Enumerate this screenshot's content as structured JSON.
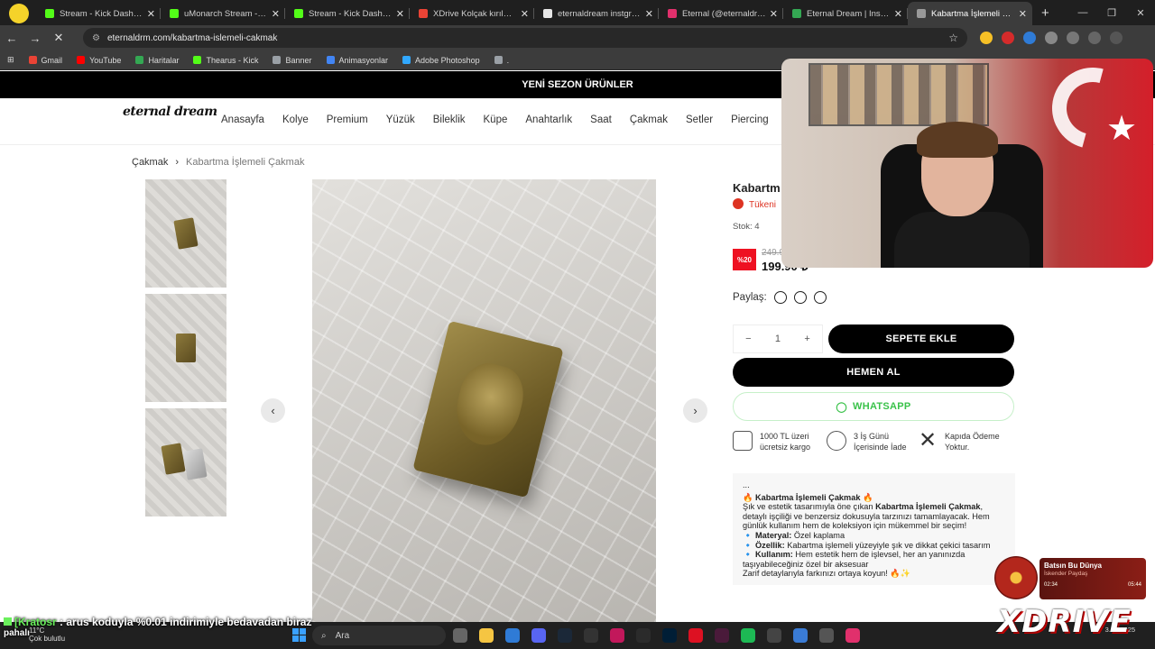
{
  "browser": {
    "tabs": [
      {
        "title": "Stream - Kick Dashboard",
        "color": "#53fc18"
      },
      {
        "title": "uMonarch Stream - Watch",
        "color": "#53fc18"
      },
      {
        "title": "Stream - Kick Dashboard",
        "color": "#53fc18"
      },
      {
        "title": "XDrive Kolçak kırılması ve",
        "color": "#ea4335"
      },
      {
        "title": "eternaldream instgram - G",
        "color": "#e6e6e6"
      },
      {
        "title": "Eternal (@eternaldrm) -",
        "color": "#e1306c"
      },
      {
        "title": "Eternal Dream | Instagram",
        "color": "#34a853"
      },
      {
        "title": "Kabartma İşlemeli Çakma",
        "color": "#999999",
        "active": true
      }
    ],
    "url": "eternaldrm.com/kabartma-islemeli-cakmak",
    "bookmarks": [
      {
        "label": "Gmail",
        "color": "#ea4335"
      },
      {
        "label": "YouTube",
        "color": "#ff0000"
      },
      {
        "label": "Haritalar",
        "color": "#34a853"
      },
      {
        "label": "Thearus - Kick",
        "color": "#53fc18"
      },
      {
        "label": "Banner",
        "color": "#9aa0a6"
      },
      {
        "label": "Animasyonlar",
        "color": "#4285f4"
      },
      {
        "label": "Adobe Photoshop",
        "color": "#31a8ff"
      },
      {
        "label": ".",
        "color": "#9aa0a6"
      }
    ]
  },
  "site": {
    "announcement": "YENİ SEZON ÜRÜNLER",
    "logo": "eternal dream",
    "menu": [
      "Anasayfa",
      "Kolye",
      "Premium",
      "Yüzük",
      "Bileklik",
      "Küpe",
      "Anahtarlık",
      "Saat",
      "Çakmak",
      "Setler",
      "Piercing",
      "Ku"
    ],
    "breadcrumb": {
      "parent": "Çakmak",
      "separator": "›",
      "current": "Kabartma İşlemeli Çakmak"
    },
    "product": {
      "title": "Kabartm",
      "stock_badge": "Tükeni",
      "stock": "Stok: 4",
      "discount": "%20",
      "old_price": "249.9",
      "price": "199.90 ₺",
      "share_label": "Paylaş:",
      "qty_minus": "−",
      "qty": "1",
      "qty_plus": "+",
      "add_to_cart": "SEPETE EKLE",
      "buy_now": "HEMEN AL",
      "whatsapp": "WHATSAPP",
      "features": [
        {
          "text": "1000 TL üzeri ücretsiz kargo",
          "icon": "truck-icon"
        },
        {
          "text": "3 İş Günü İçerisinde İade",
          "icon": "recycle-icon"
        },
        {
          "text": "Kapıda Ödeme Yoktur.",
          "icon": "close-icon"
        }
      ],
      "desc_dots": "...",
      "desc_title": "🔥 Kabartma İşlemeli Çakmak 🔥",
      "desc_intro_a": "Şık ve estetik tasarımıyla öne çıkan ",
      "desc_intro_b": "Kabartma İşlemeli Çakmak",
      "desc_intro_c": ", detaylı işçiliği ve benzersiz dokusuyla tarzınızı tamamlayacak. Hem günlük kullanım hem de koleksiyon için mükemmel bir seçim!",
      "desc_mat_k": "🔹 Materyal:",
      "desc_mat_v": " Özel kaplama",
      "desc_oz_k": "🔹 Özellik:",
      "desc_oz_v": " Kabartma işlemeli yüzeyiyle şık ve dikkat çekici tasarım",
      "desc_ku_k": "🔹 Kullanım:",
      "desc_ku_v": " Hem estetik hem de işlevsel, her an yanınızda taşıyabileceğiniz özel bir aksesuar",
      "desc_end": "Zarif detaylarıyla farkınızı ortaya koyun! 🔥✨"
    }
  },
  "overlay": {
    "chat_user": "[Kratosr",
    "chat_msg": " : arus koduyla %0.01 indirimiyle bedavadan biraz",
    "chat_tail": "pahalı",
    "song_title": "Batsın Bu Dünya",
    "song_artist": "İskender Paydaş",
    "song_elapsed": "02:34",
    "song_total": "05:44",
    "brand": "XDRIVE"
  },
  "taskbar": {
    "weather_temp": "11°C",
    "weather_desc": "Çok bulutlu",
    "search": "Ara",
    "date": "3.12.2025"
  }
}
